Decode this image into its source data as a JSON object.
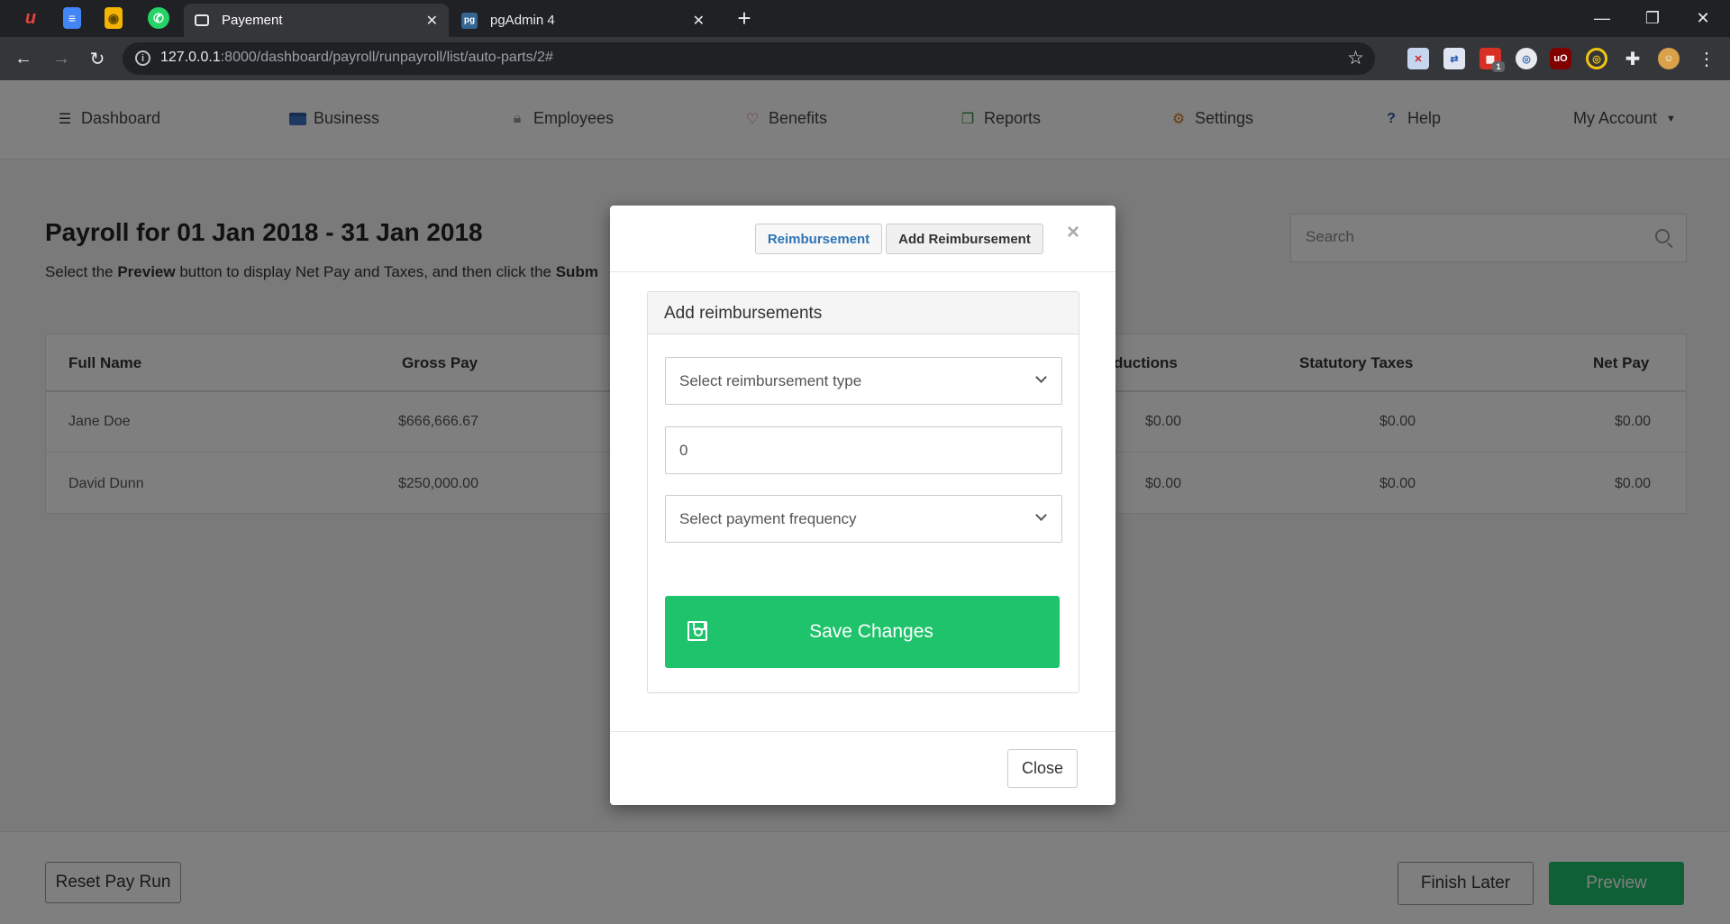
{
  "browser": {
    "tabs": [
      {
        "title": "Payement",
        "active": true
      },
      {
        "title": "pgAdmin 4",
        "active": false
      }
    ],
    "url_host": "127.0.0.1",
    "url_rest": ":8000/dashboard/payroll/runpayroll/list/auto-parts/2#",
    "extension_badge": "1"
  },
  "nav": {
    "items": [
      {
        "label": "Dashboard",
        "icon": "bars-icon"
      },
      {
        "label": "Business",
        "icon": "credit-card-icon"
      },
      {
        "label": "Employees",
        "icon": "lock-icon"
      },
      {
        "label": "Benefits",
        "icon": "heart-icon"
      },
      {
        "label": "Reports",
        "icon": "copy-icon"
      },
      {
        "label": "Settings",
        "icon": "gear-icon"
      },
      {
        "label": "Help",
        "icon": "question-icon"
      }
    ],
    "account_label": "My Account"
  },
  "page": {
    "title": "Payroll for 01 Jan 2018 - 31 Jan 2018",
    "subtitle_pre": "Select the ",
    "subtitle_bold1": "Preview",
    "subtitle_mid": " button to display Net Pay and Taxes, and then click the ",
    "subtitle_bold2": "Subm",
    "search_placeholder": "Search"
  },
  "table": {
    "headers": {
      "full_name": "Full Name",
      "gross_pay": "Gross Pay",
      "deductions": "ductions",
      "statutory_taxes": "Statutory Taxes",
      "net_pay": "Net Pay"
    },
    "rows": [
      {
        "name": "Jane Doe",
        "gross": "$666,666.67",
        "deductions": "$0.00",
        "taxes": "$0.00",
        "net": "$0.00"
      },
      {
        "name": "David Dunn",
        "gross": "$250,000.00",
        "deductions": "$0.00",
        "taxes": "$0.00",
        "net": "$0.00"
      }
    ]
  },
  "footer": {
    "reset_label": "Reset Pay Run",
    "finish_later_label": "Finish Later",
    "preview_label": "Preview"
  },
  "modal": {
    "tab_active": "Reimbursement",
    "tab_add": "Add Reimbursement",
    "close_x": "×",
    "panel_title": "Add reimbursements",
    "type_placeholder": "Select reimbursement type",
    "amount_value": "0",
    "frequency_placeholder": "Select payment frequency",
    "save_label": "Save Changes",
    "close_label": "Close"
  },
  "colors": {
    "accent_green": "#1fc36b",
    "active_tab_blue": "#2f74b5"
  }
}
